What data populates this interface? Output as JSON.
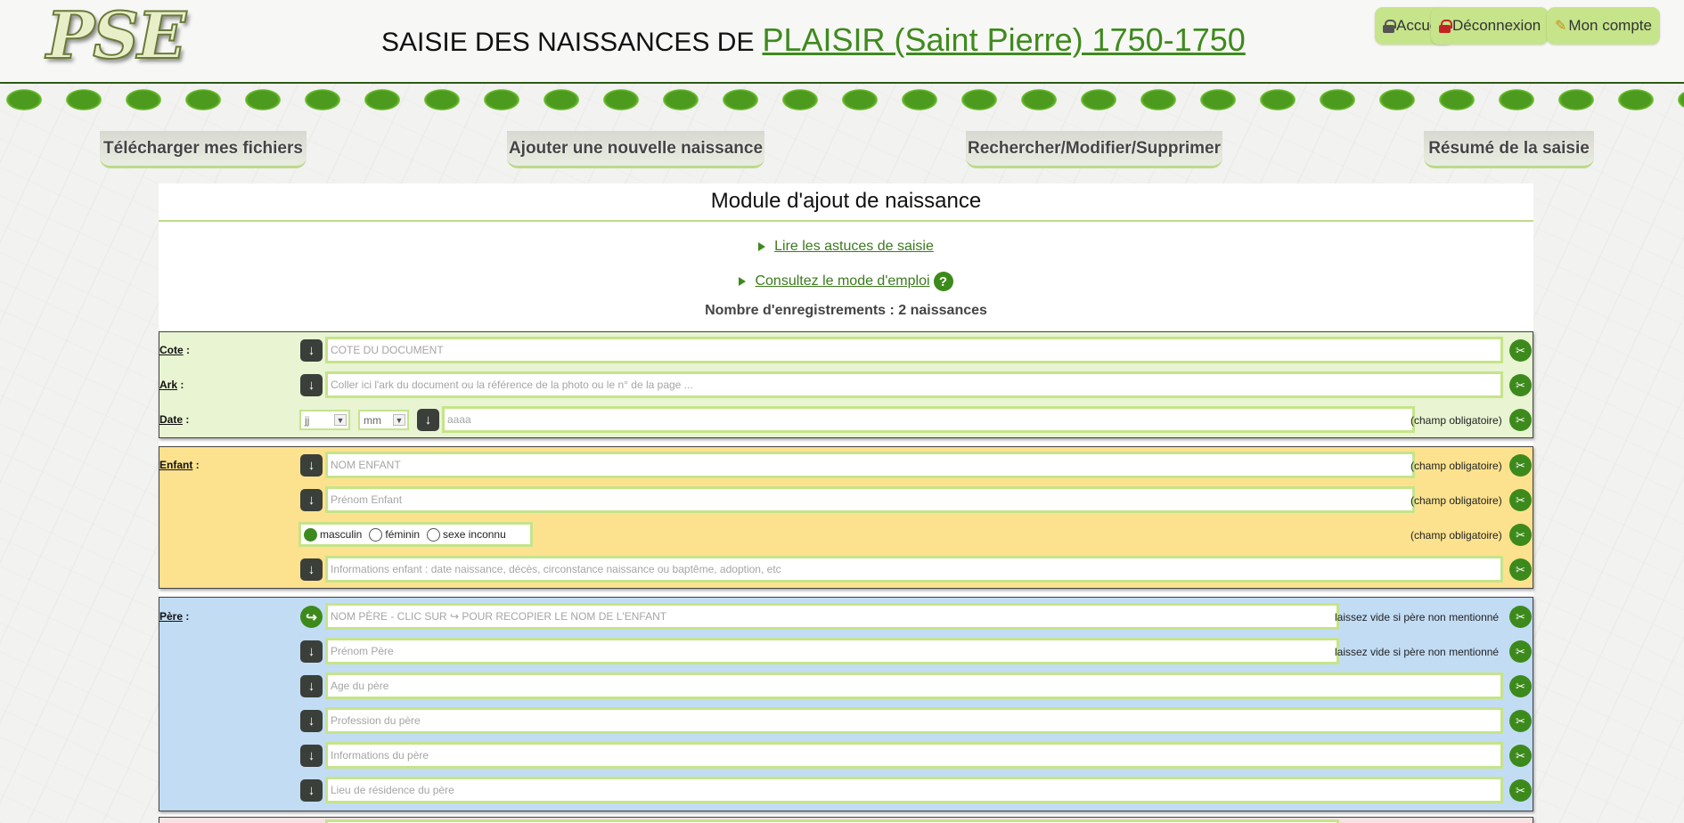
{
  "header": {
    "logo": "PSE",
    "title_prefix": "SAISIE DES NAISSANCES DE",
    "title_place": "PLAISIR (Saint Pierre) 1750-1750",
    "buttons": [
      {
        "label": "Accueil",
        "icon": "lock-icon"
      },
      {
        "label": "Déconnexion",
        "icon": "lock-red-icon"
      },
      {
        "label": "Mon compte",
        "icon": "pencil-icon"
      }
    ]
  },
  "nav": [
    {
      "label": "Télécharger mes fichiers"
    },
    {
      "label": "Ajouter une nouvelle naissance"
    },
    {
      "label": "Rechercher/Modifier/Supprimer"
    },
    {
      "label": "Résumé de la saisie"
    }
  ],
  "panel": {
    "title": "Module d'ajout de naissance",
    "link_tips": "Lire les astuces de saisie",
    "link_manual": "Consultez le mode d'emploi",
    "help_glyph": "?",
    "count": "Nombre d'enregistrements : 2 naissances"
  },
  "document": {
    "cote_label": "Cote",
    "ark_label": "Ark",
    "date_label": "Date",
    "cote_placeholder": "COTE DU DOCUMENT",
    "ark_placeholder": "Coller ici l'ark du document ou la référence de la photo ou le n° de la page ...",
    "day_select": "jj",
    "month_select": "mm",
    "year_placeholder": "aaaa",
    "required_note": "(champ obligatoire)"
  },
  "child": {
    "label": "Enfant",
    "name_placeholder": "NOM ENFANT",
    "firstname_placeholder": "Prénom Enfant",
    "sex_options": [
      "masculin",
      "féminin",
      "sexe inconnu"
    ],
    "sex_selected": "masculin",
    "info_placeholder": "Informations enfant : date naissance, décès, circonstance naissance ou baptême, adoption, etc",
    "required_note": "(champ obligatoire)"
  },
  "father": {
    "label": "Père",
    "name_placeholder": "NOM PÈRE - CLIC SUR ↪ POUR RECOPIER LE NOM DE L'ENFANT",
    "firstname_placeholder": "Prénom Père",
    "age_placeholder": "Age du père",
    "profession_placeholder": "Profession du père",
    "info_placeholder": "Informations du père",
    "residence_placeholder": "Lieu de résidence du père",
    "empty_note": "laissez vide si père non mentionné"
  },
  "colors": {
    "accent": "#3d8a1c",
    "field_border": "#c5e48a",
    "doc_bg": "#e8f4d2",
    "child_bg": "#fce28e",
    "father_bg": "#c2dcf4",
    "mother_bg": "#f9e2e2"
  }
}
